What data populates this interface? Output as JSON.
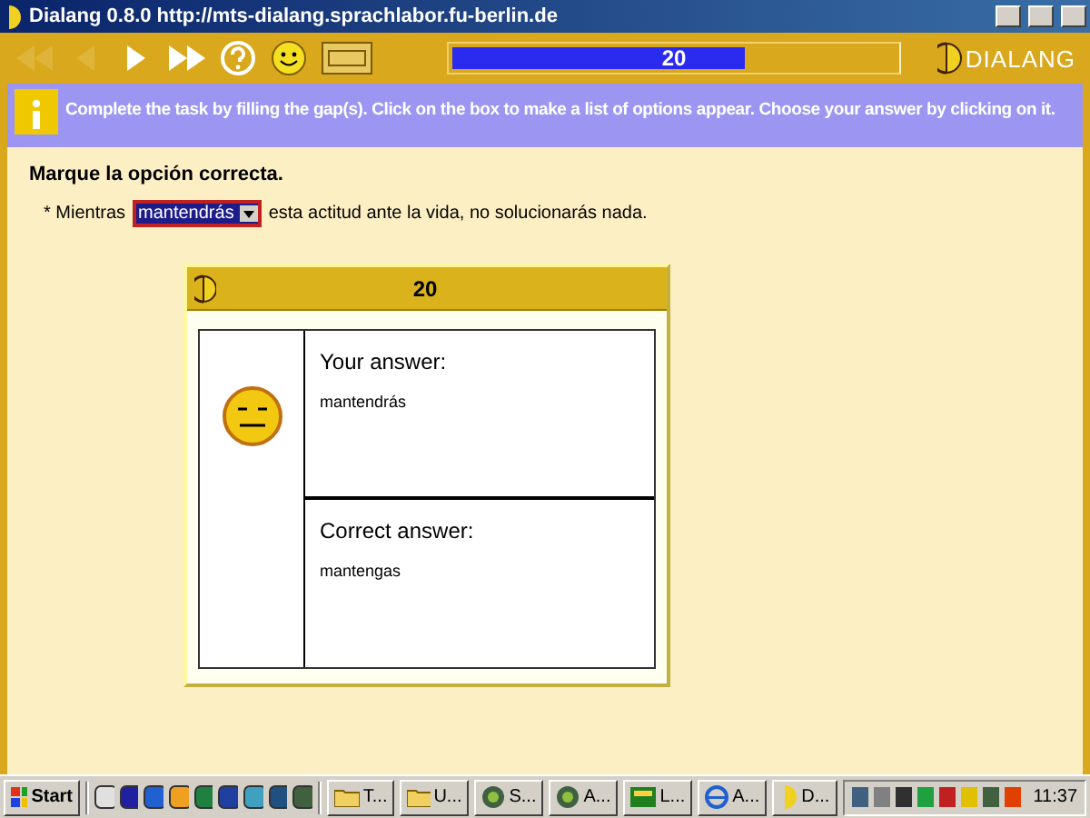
{
  "window": {
    "title": "Dialang 0.8.0 http://mts-dialang.sprachlabor.fu-berlin.de"
  },
  "toolbar": {
    "buttons": [
      {
        "kind": "first",
        "disabled": true
      },
      {
        "kind": "back",
        "disabled": true
      },
      {
        "kind": "next",
        "disabled": false
      },
      {
        "kind": "last",
        "disabled": false
      },
      {
        "kind": "help",
        "disabled": false
      },
      {
        "kind": "smiley",
        "disabled": false
      },
      {
        "kind": "keyboard",
        "disabled": false
      }
    ],
    "progress": {
      "level": 0.66,
      "reading": "20"
    },
    "logo": "DIALANG"
  },
  "instruction": "Complete the task by filling the gap(s). Click on the box to make a list of options appear. Choose your answer by clicking on it.",
  "task": {
    "heading": "Marque la opción correcta.",
    "before": "* Mientras",
    "gap": {
      "value": "mantendrás"
    },
    "after": "esta actitud ante la vida, no solucionarás nada."
  },
  "feedback": {
    "number": "20",
    "correct": false,
    "your_label": "Your answer:",
    "your_answer": "mantendrás",
    "correct_label": "Correct answer:",
    "correct_answer": "mantengas"
  },
  "taskbar": {
    "start": "Start",
    "tasks": [
      {
        "label": "T..."
      },
      {
        "label": "U..."
      },
      {
        "label": "S..."
      },
      {
        "label": "A..."
      },
      {
        "label": "L..."
      },
      {
        "label": "A..."
      },
      {
        "label": "D..."
      }
    ],
    "clock": "11:37"
  }
}
